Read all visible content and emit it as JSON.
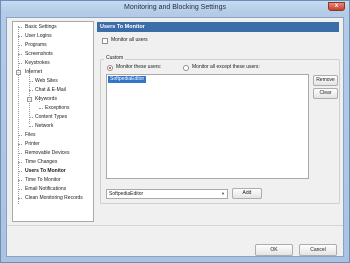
{
  "window": {
    "title": "Monitoring and Blocking Settings",
    "close_label": "x"
  },
  "tree": {
    "items": [
      {
        "label": "Basic Settings"
      },
      {
        "label": "User Logins"
      },
      {
        "label": "Programs"
      },
      {
        "label": "Screenshots"
      },
      {
        "label": "Keystrokes"
      },
      {
        "label": "Internet"
      },
      {
        "label": "Web Sites"
      },
      {
        "label": "Chat & E-Mail"
      },
      {
        "label": "Keywords"
      },
      {
        "label": "Exceptions"
      },
      {
        "label": "Content Types"
      },
      {
        "label": "Network"
      },
      {
        "label": "Files"
      },
      {
        "label": "Printer"
      },
      {
        "label": "Removable Devices"
      },
      {
        "label": "Time Changes"
      },
      {
        "label": "Users To Monitor"
      },
      {
        "label": "Time To Monitor"
      },
      {
        "label": "Email Notifications"
      },
      {
        "label": "Clean Monitoring Records"
      }
    ],
    "selected": "Users To Monitor"
  },
  "panel": {
    "header": "Users To Monitor",
    "monitor_all_label": "Monitor all users",
    "monitor_all_checked": false,
    "group_label": "Custom",
    "radio_these_label": "Monitor these users:",
    "radio_except_label": "Monitor all except these users:",
    "selected_mode": "these",
    "users": [
      "SoftpediaEditor"
    ],
    "remove_label": "Remove",
    "clear_label": "Clear",
    "user_select_value": "SoftpediaEditor",
    "add_label": "Add"
  },
  "footer": {
    "ok_label": "OK",
    "cancel_label": "Cancel"
  },
  "colors": {
    "header_bg": "#3b6ea8",
    "selection_bg": "#3375c6",
    "title_bar": "#b3cbe7"
  }
}
